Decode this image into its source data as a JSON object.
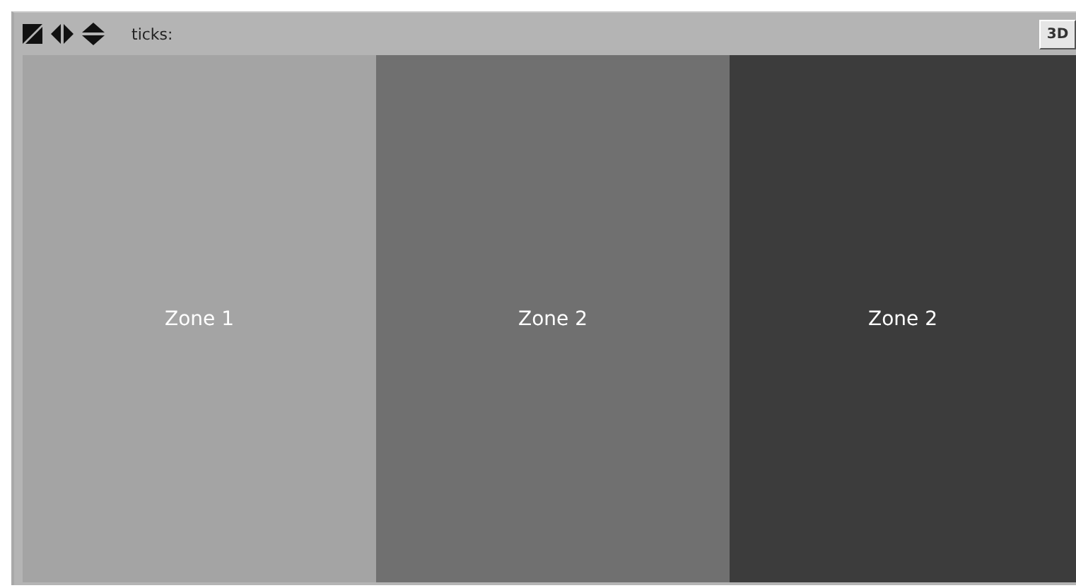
{
  "toolbar": {
    "ticks_label": "ticks:",
    "view_button": "3D"
  },
  "zones": [
    {
      "label": "Zone 1",
      "color": "#a4a4a4"
    },
    {
      "label": "Zone 2",
      "color": "#707070"
    },
    {
      "label": "Zone 2",
      "color": "#3c3c3c"
    }
  ]
}
